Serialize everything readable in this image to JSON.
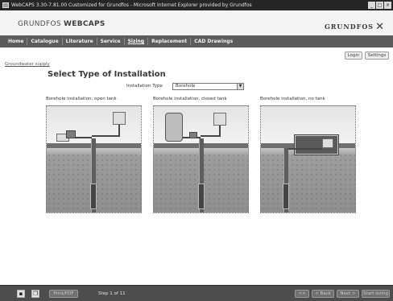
{
  "window": {
    "title": "WebCAPS 3.30-7.81.00 Customized for Grundfos - Microsoft Internet Explorer provided by Grundfos",
    "controls": [
      "_",
      "□",
      "×"
    ]
  },
  "header": {
    "brand_prefix": "GRUNDFOS ",
    "brand_strong": "WEBCAPS",
    "logo_text": "GRUNDFOS",
    "logo_mark": "✕"
  },
  "nav": {
    "items": [
      "Home",
      "Catalogue",
      "Literature",
      "Service",
      "Sizing",
      "Replacement",
      "CAD Drawings"
    ],
    "active": "Sizing"
  },
  "top_buttons": {
    "login": "Login",
    "settings": "Settings"
  },
  "breadcrumb": "Groundwater supply",
  "main": {
    "heading": "Select Type of Installation",
    "installation_type_label": "Installation Type",
    "installation_type_value": "Borehole",
    "options": [
      {
        "label": "Borehole installation, open tank"
      },
      {
        "label": "Borehole installation, closed tank"
      },
      {
        "label": "Borehole installation, no tank"
      }
    ]
  },
  "footer": {
    "print_label": "Print/PDF",
    "step_text": "Step 1 of 11",
    "first_label": "<<",
    "back_label": "< Back",
    "next_label": "Next >",
    "start_label": "Start sizing"
  },
  "icons": {
    "save": "save-icon",
    "copy": "copy-icon"
  }
}
